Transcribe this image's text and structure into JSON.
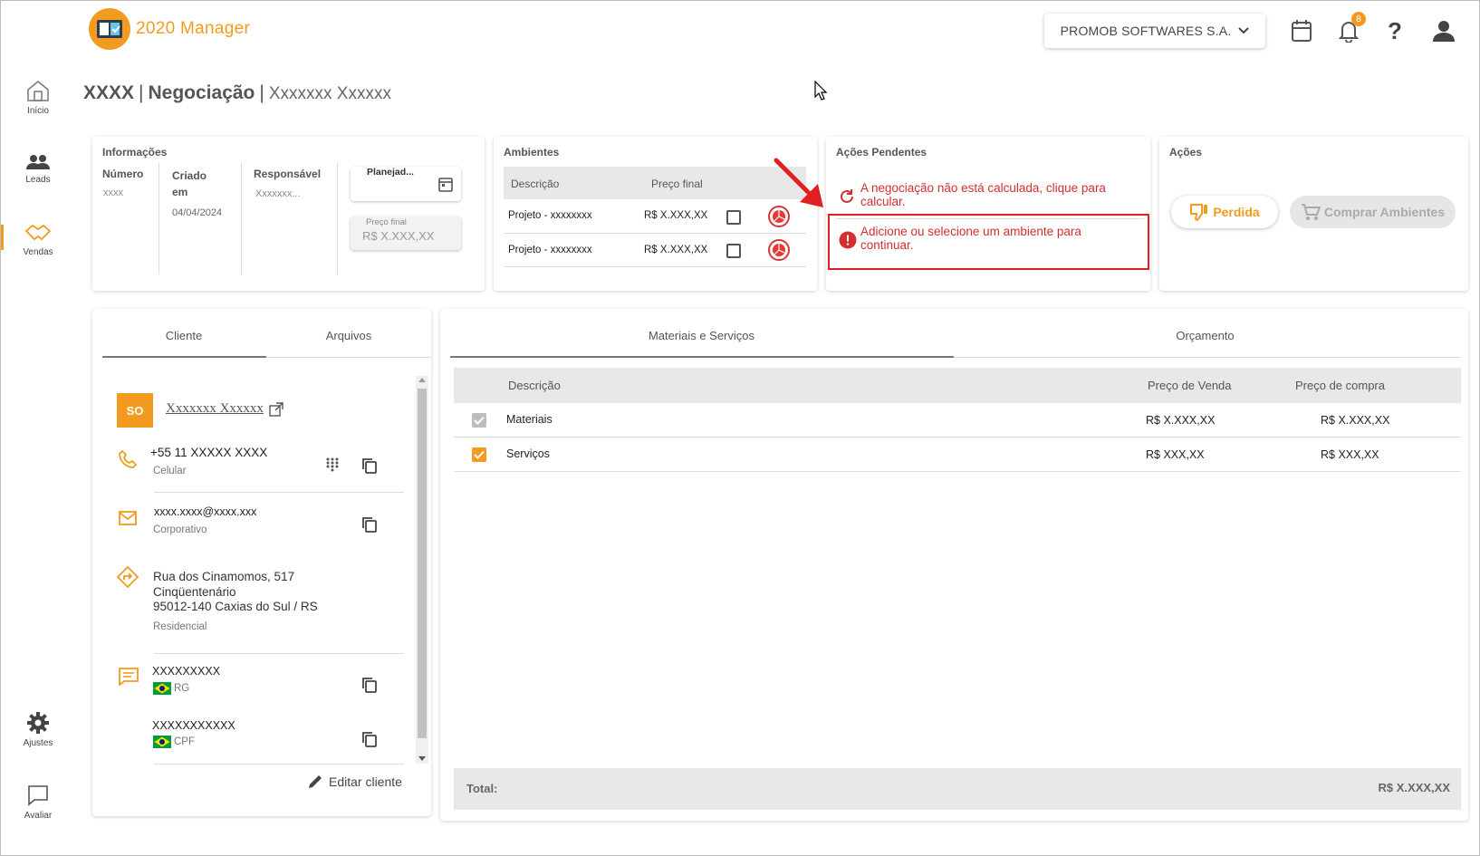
{
  "app": {
    "name": "2020 Manager"
  },
  "colors": {
    "accent": "#f29b1e",
    "error": "#d32f2f",
    "highlight_box": "#e02020"
  },
  "header": {
    "company": "PROMOB SOFTWARES S.A.",
    "notifications_count": "8",
    "icons": [
      "calendar-icon",
      "bell-icon",
      "help-icon",
      "user-icon"
    ]
  },
  "sidebar": {
    "items": [
      {
        "label": "Início",
        "icon": "home-icon"
      },
      {
        "label": "Leads",
        "icon": "people-icon"
      },
      {
        "label": "Vendas",
        "icon": "handshake-icon"
      }
    ],
    "bottom": [
      {
        "label": "Ajustes",
        "icon": "gear-icon"
      },
      {
        "label": "Avaliar",
        "icon": "chat-icon"
      }
    ]
  },
  "page": {
    "title_code": "XXXX",
    "title_sep1": "|",
    "title_main": "Negociação",
    "title_sep2": "|",
    "title_client": "Xxxxxxx Xxxxxx"
  },
  "info": {
    "title": "Informações",
    "numero_label": "Número",
    "numero_value": "xxxx",
    "criado_label": "Criado em",
    "criado_value": "04/04/2024",
    "responsavel_label": "Responsável",
    "responsavel_value": "Xxxxxxx...",
    "status_value": "Planejad...",
    "preco_final_label": "Preço final",
    "preco_final_value": "R$ X.XXX,XX"
  },
  "ambientes": {
    "title": "Ambientes",
    "col_desc": "Descrição",
    "col_price": "Preço final",
    "rows": [
      {
        "desc": "Projeto - xxxxxxxx",
        "price": "R$ X.XXX,XX"
      },
      {
        "desc": "Projeto - xxxxxxxx",
        "price": "R$ X.XXX,XX"
      }
    ]
  },
  "pendentes": {
    "title": "Ações Pendentes",
    "items": [
      {
        "text1": "A negociação não está calculada, clique para",
        "text2": "calcular.",
        "icon": "refresh-icon"
      },
      {
        "text1": "Adicione ou selecione um ambiente para",
        "text2": "continuar.",
        "icon": "error-icon"
      }
    ]
  },
  "acoes": {
    "title": "Ações",
    "lost_label": "Perdida",
    "buy_label": "Comprar Ambientes"
  },
  "left_tabs": {
    "cliente": "Cliente",
    "arquivos": "Arquivos"
  },
  "client": {
    "initials": "SO",
    "name": "Xxxxxxx Xxxxxx",
    "phone": "+55 11 XXXXX XXXX",
    "phone_type": "Celular",
    "email": "xxxx.xxxx@xxxx.xxx",
    "email_type": "Corporativo",
    "address_line1": "Rua dos Cinamomos, 517",
    "address_line2": "Cinqüentenário",
    "address_line3": "95012-140 Caxias do Sul / RS",
    "address_type": "Residencial",
    "doc1_value": "XXXXXXXXX",
    "doc1_type": "RG",
    "doc2_value": "XXXXXXXXXXX",
    "doc2_type": "CPF",
    "edit_label": "Editar cliente"
  },
  "right_tabs": {
    "materiais": "Materiais e Serviços",
    "orcamento": "Orçamento"
  },
  "materials": {
    "col_desc": "Descrição",
    "col_sale": "Preço de Venda",
    "col_buy": "Preço de compra",
    "rows": [
      {
        "desc": "Materiais",
        "sale": "R$ X.XXX,XX",
        "buy": "R$ X.XXX,XX",
        "checked": true,
        "disabled": true
      },
      {
        "desc": "Serviços",
        "sale": "R$ XXX,XX",
        "buy": "R$ XXX,XX",
        "checked": true,
        "disabled": false
      }
    ],
    "total_label": "Total:",
    "total_value": "R$ X.XXX,XX"
  }
}
